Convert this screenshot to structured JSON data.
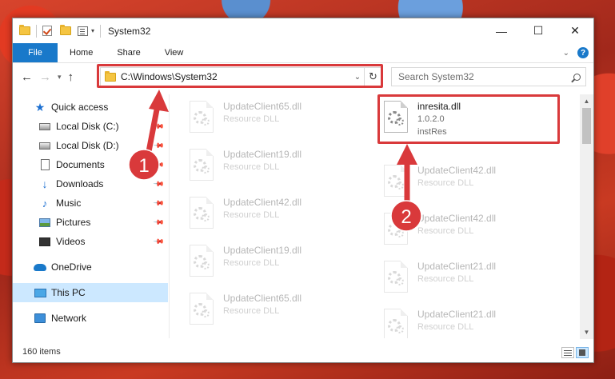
{
  "window": {
    "title": "System32",
    "controls": {
      "minimize": "—",
      "maximize": "☐",
      "close": "✕"
    }
  },
  "ribbon": {
    "tabs": [
      "File",
      "Home",
      "Share",
      "View"
    ],
    "help": "?"
  },
  "address_bar": {
    "path": "C:\\Windows\\System32"
  },
  "search": {
    "placeholder": "Search System32"
  },
  "nav_pane": {
    "items": [
      {
        "label": "Quick access",
        "icon": "star-icon",
        "pinned": false
      },
      {
        "label": "Local Disk (C:)",
        "icon": "disk-icon",
        "pinned": true
      },
      {
        "label": "Local Disk (D:)",
        "icon": "disk-icon",
        "pinned": true
      },
      {
        "label": "Documents",
        "icon": "documents-icon",
        "pinned": true
      },
      {
        "label": "Downloads",
        "icon": "downloads-icon",
        "pinned": true
      },
      {
        "label": "Music",
        "icon": "music-icon",
        "pinned": true
      },
      {
        "label": "Pictures",
        "icon": "pictures-icon",
        "pinned": true
      },
      {
        "label": "Videos",
        "icon": "videos-icon",
        "pinned": true
      },
      {
        "label": "OneDrive",
        "icon": "onedrive-icon",
        "pinned": false
      },
      {
        "label": "This PC",
        "icon": "this-pc-icon",
        "pinned": false,
        "selected": true
      },
      {
        "label": "Network",
        "icon": "network-icon",
        "pinned": false
      }
    ]
  },
  "files": {
    "highlighted": {
      "name": "inresita.dll",
      "version": "1.0.2.0",
      "company": "instRes"
    },
    "left_column": [
      {
        "name": "UpdateClient65.dll",
        "type": "Resource DLL"
      },
      {
        "name": "UpdateClient19.dll",
        "type": "Resource DLL"
      },
      {
        "name": "UpdateClient42.dll",
        "type": "Resource DLL"
      },
      {
        "name": "UpdateClient19.dll",
        "type": "Resource DLL"
      },
      {
        "name": "UpdateClient65.dll",
        "type": "Resource DLL"
      }
    ],
    "right_column": [
      {
        "name": "UpdateClient42.dll",
        "type": "Resource DLL"
      },
      {
        "name": "UpdateClient42.dll",
        "type": "Resource DLL"
      },
      {
        "name": "UpdateClient21.dll",
        "type": "Resource DLL"
      },
      {
        "name": "UpdateClient21.dll",
        "type": "Resource DLL"
      }
    ]
  },
  "status_bar": {
    "item_count": "160 items"
  },
  "annotations": {
    "badge_1": "1",
    "badge_2": "2",
    "color": "#d9393b"
  },
  "colors": {
    "accent": "#1979ca",
    "selection": "#cce8ff"
  }
}
